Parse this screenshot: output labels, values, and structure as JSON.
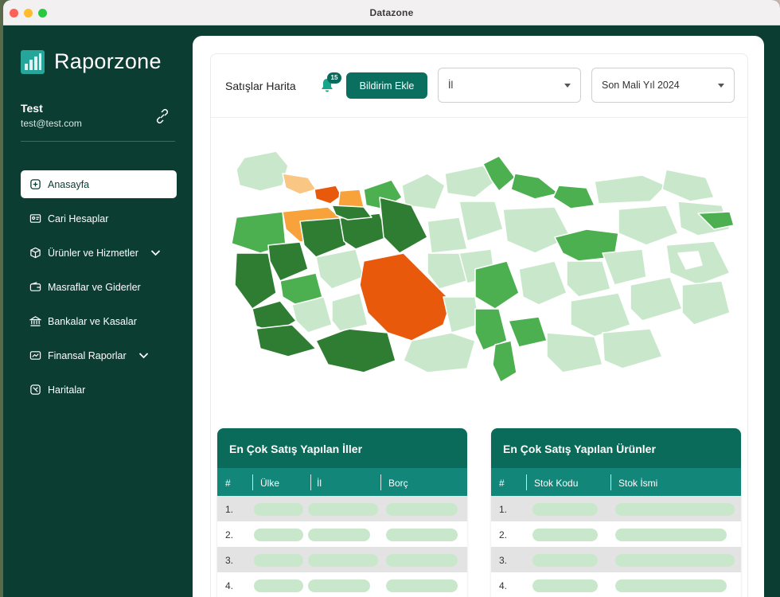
{
  "window": {
    "title": "Datazone"
  },
  "sidebar": {
    "brand": "Raporzone",
    "user": {
      "name": "Test",
      "email": "test@test.com"
    },
    "nav": [
      {
        "label": "Anasayfa",
        "icon": "home-icon",
        "active": true
      },
      {
        "label": "Cari Hesaplar",
        "icon": "id-card-icon"
      },
      {
        "label": "Ürünler ve Hizmetler",
        "icon": "box-icon",
        "expandable": true
      },
      {
        "label": "Masraflar ve Giderler",
        "icon": "wallet-icon"
      },
      {
        "label": "Bankalar ve Kasalar",
        "icon": "bank-icon"
      },
      {
        "label": "Finansal Raporlar",
        "icon": "report-icon",
        "expandable": true
      },
      {
        "label": "Haritalar",
        "icon": "map-icon"
      }
    ]
  },
  "header": {
    "title": "Satışlar Harita",
    "notification_count": "15",
    "add_notification_button": "Bildirim Ekle",
    "province_select": {
      "value": "İl"
    },
    "period_select": {
      "value": "Son Mali Yıl 2024"
    }
  },
  "tables": {
    "provinces": {
      "title": "En Çok Satış Yapılan İller",
      "columns": [
        "#",
        "Ülke",
        "İl",
        "Borç"
      ],
      "rows": [
        "1.",
        "2.",
        "3.",
        "4."
      ]
    },
    "products": {
      "title": "En Çok Satış Yapılan Ürünler",
      "columns": [
        "#",
        "Stok Kodu",
        "Stok İsmi"
      ],
      "rows": [
        "1.",
        "2.",
        "3.",
        "4."
      ]
    }
  },
  "colors": {
    "sidebar_bg": "#0b3d33",
    "accent": "#0b6f60",
    "table_header": "#13867a",
    "map_light": "#c9e8cb",
    "map_mid": "#4caf50",
    "map_dark": "#2e7d32",
    "map_hot": "#e8590c",
    "map_warm": "#f7a23b"
  }
}
